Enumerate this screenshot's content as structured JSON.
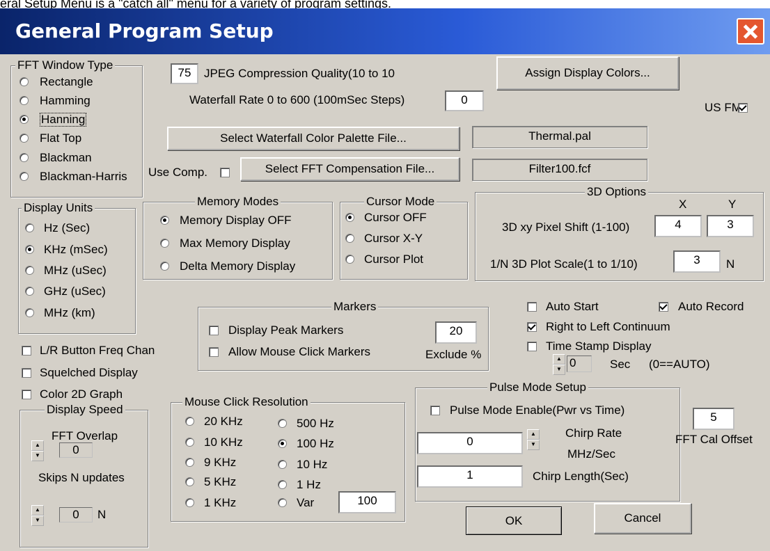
{
  "caption": "eral Setup Menu is a \"catch all\" menu for a variety of program settings.",
  "title": "General Program Setup",
  "icons": {
    "close": "close-icon",
    "up": "spin-up-icon",
    "down": "spin-down-icon"
  },
  "fft_window": {
    "legend": "FFT Window Type",
    "options": [
      "Rectangle",
      "Hamming",
      "Hanning",
      "Flat Top",
      "Blackman",
      "Blackman-Harris"
    ],
    "selected": "Hanning"
  },
  "jpeg": {
    "value": "75",
    "label": "JPEG Compression Quality(10 to 10"
  },
  "waterfall_rate": {
    "label": "Waterfall Rate 0 to 600 (100mSec Steps)",
    "value": "0"
  },
  "assign_colors_button": "Assign Display Colors...",
  "us_fm": {
    "label": "US FM",
    "checked": true
  },
  "palette_button": "Select Waterfall Color Palette File...",
  "palette_file": "Thermal.pal",
  "use_comp": {
    "label": "Use Comp.",
    "checked": false
  },
  "compensation_button": "Select FFT Compensation File...",
  "compensation_file": "Filter100.fcf",
  "display_units": {
    "legend": "Display Units",
    "options": [
      "Hz (Sec)",
      "KHz (mSec)",
      "MHz (uSec)",
      "GHz (uSec)",
      "MHz (km)"
    ],
    "selected": "KHz (mSec)"
  },
  "memory_modes": {
    "legend": "Memory Modes",
    "options": [
      "Memory Display OFF",
      "Max Memory Display",
      "Delta Memory Display"
    ],
    "selected": "Memory Display OFF"
  },
  "cursor_mode": {
    "legend": "Cursor Mode",
    "options": [
      "Cursor OFF",
      "Cursor X-Y",
      "Cursor Plot"
    ],
    "selected": "Cursor OFF"
  },
  "options3d": {
    "legend": "3D Options",
    "x_header": "X",
    "y_header": "Y",
    "shift_label": "3D xy Pixel Shift (1-100)",
    "x_value": "4",
    "y_value": "3",
    "scale_label": "1/N 3D Plot Scale(1 to 1/10)",
    "scale_value": "3",
    "scale_unit": "N"
  },
  "checks_left": [
    {
      "label": "L/R Button Freq Chan",
      "checked": false
    },
    {
      "label": "Squelched Display",
      "checked": false
    },
    {
      "label": "Color 2D Graph",
      "checked": false
    }
  ],
  "markers": {
    "legend": "Markers",
    "peak_label": "Display Peak Markers",
    "mouse_label": "Allow Mouse Click Markers",
    "exclude_value": "20",
    "exclude_label": "Exclude %"
  },
  "auto_start": {
    "label": "Auto Start",
    "checked": false
  },
  "auto_record": {
    "label": "Auto Record",
    "checked": true
  },
  "right_to_left": {
    "label": "Right to Left Continuum",
    "checked": true
  },
  "time_stamp": {
    "label": "Time Stamp Display",
    "checked": false
  },
  "timestamp_spin": {
    "value": "0",
    "unit": "Sec",
    "note": "(0==AUTO)"
  },
  "display_speed": {
    "legend": "Display Speed",
    "overlap_label": "FFT Overlap",
    "overlap_value": "0",
    "skips_label": "Skips N updates",
    "skips_value": "0",
    "skips_unit": "N"
  },
  "mouse_res": {
    "legend": "Mouse Click Resolution",
    "left_options": [
      "20 KHz",
      "10 KHz",
      "9 KHz",
      "5 KHz",
      "1 KHz"
    ],
    "right_options": [
      "500 Hz",
      "100 Hz",
      "10 Hz",
      "1 Hz",
      "Var"
    ],
    "selected": "100 Hz",
    "var_value": "100"
  },
  "pulse_mode": {
    "legend": "Pulse Mode Setup",
    "enable_label": "Pulse Mode Enable(Pwr vs Time)",
    "enabled": false,
    "chirp_rate_value": "0",
    "chirp_rate_label": "Chirp Rate",
    "chirp_rate_unit": "MHz/Sec",
    "chirp_length_value": "1",
    "chirp_length_label": "Chirp Length(Sec)"
  },
  "fft_cal": {
    "value": "5",
    "label": "FFT Cal Offset"
  },
  "ok_button": "OK",
  "cancel_button": "Cancel"
}
